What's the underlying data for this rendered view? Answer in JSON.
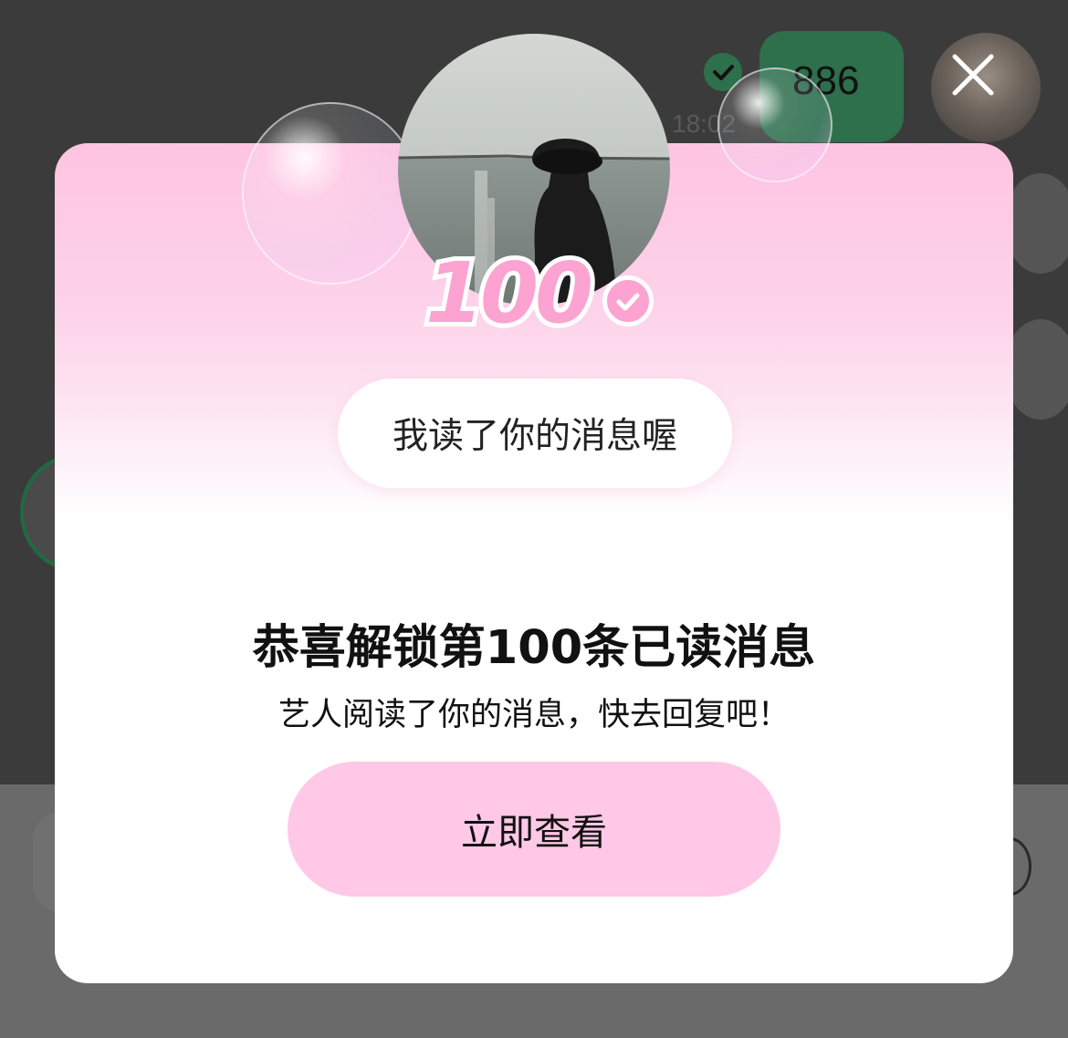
{
  "chat": {
    "sent_message": "886",
    "time": "18:02"
  },
  "modal": {
    "read_count": "100",
    "speech_text": "我读了你的消息喔",
    "title": "恭喜解锁第100条已读消息",
    "subtitle": "艺人阅读了你的消息，快去回复吧！",
    "cta_label": "立即查看"
  },
  "colors": {
    "pink_accent": "#fca3d1",
    "button_pink": "#ffc8e6",
    "chat_green": "#2e6f4c"
  },
  "icons": [
    "close-icon",
    "read-check-icon",
    "check-badge-icon",
    "plus-icon"
  ]
}
